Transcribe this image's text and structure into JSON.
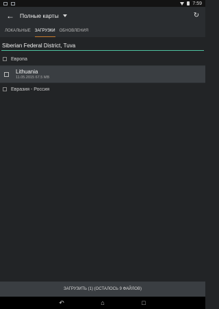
{
  "status_bar": {
    "time": "7:59"
  },
  "app_bar": {
    "title": "Полные карты"
  },
  "tabs": [
    {
      "label": "ЛОКАЛЬНЫЕ",
      "active": false
    },
    {
      "label": "ЗАГРУЗКИ",
      "active": true
    },
    {
      "label": "ОБНОВЛЕНИЯ",
      "active": false
    }
  ],
  "search": {
    "value": "Siberian Federal District, Tuva"
  },
  "list": {
    "group_europe": {
      "label": "Европа"
    },
    "item_lithuania": {
      "title": "Lithuania",
      "meta": "11.05.2015 67.5 MB"
    },
    "group_eurasia": {
      "label": "Евразия - Россия"
    }
  },
  "bottom_action": {
    "label": "ЗАГРУЗИТЬ  (1) (ОСТАЛОСЬ 9 ФАЙЛОВ)"
  },
  "icons": {
    "back": "arrow-left-icon",
    "dropdown": "caret-down-icon",
    "refresh": "refresh-icon",
    "nav_back": "back-icon",
    "nav_home": "home-icon",
    "nav_recent": "recent-apps-icon"
  },
  "colors": {
    "accent_orange": "#c87a2b",
    "search_underline": "#4fc3a1"
  }
}
